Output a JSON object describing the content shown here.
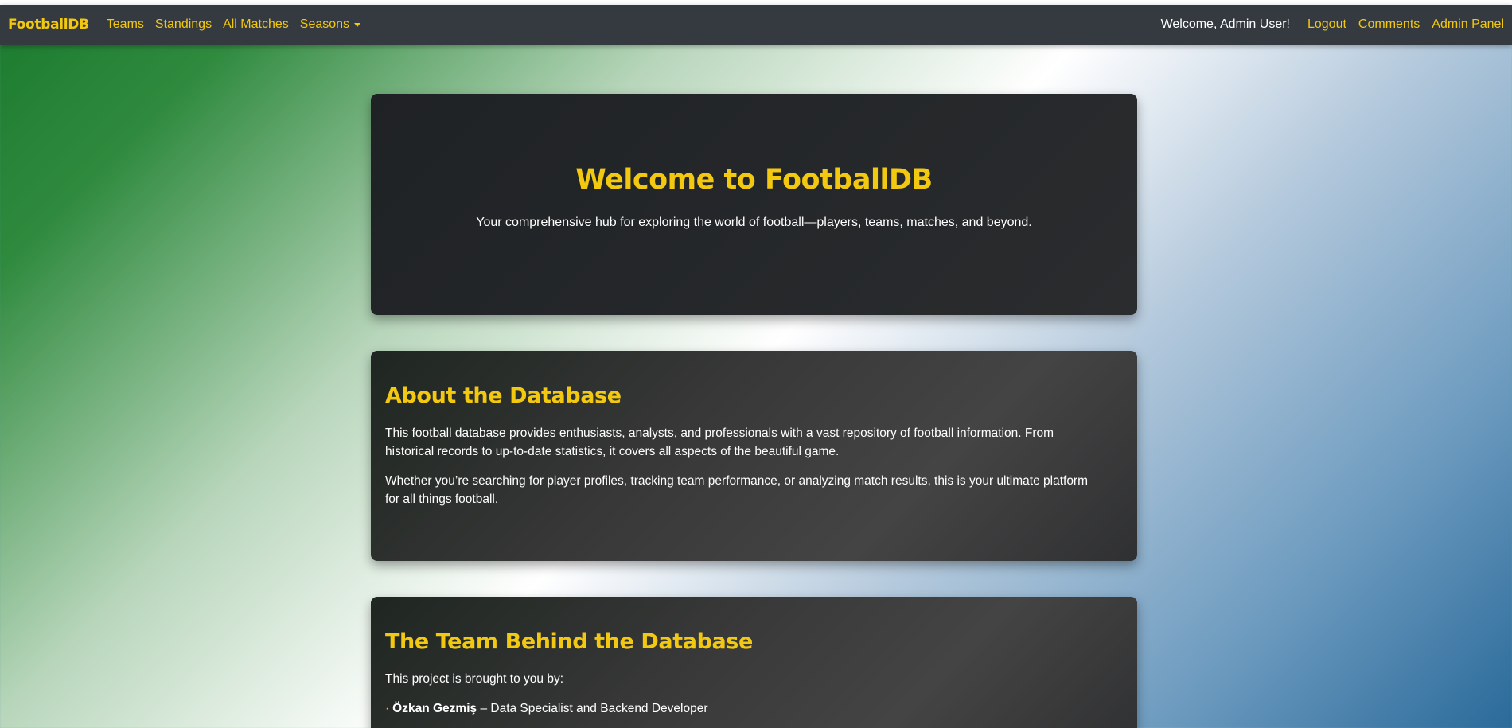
{
  "navbar": {
    "brand": "FootballDB",
    "links": [
      "Teams",
      "Standings",
      "All Matches",
      "Seasons"
    ],
    "welcome": "Welcome, Admin User!",
    "right_links": [
      "Logout",
      "Comments",
      "Admin Panel"
    ]
  },
  "hero": {
    "title": "Welcome to FootballDB",
    "subtitle": "Your comprehensive hub for exploring the world of football—players, teams, matches, and beyond."
  },
  "about": {
    "title": "About the Database",
    "paragraphs": [
      "This football database provides enthusiasts, analysts, and professionals with a vast repository of football information. From historical records to up-to-date statistics, it covers all aspects of the beautiful game.",
      "Whether you’re searching for player profiles, tracking team performance, or analyzing match results, this is your ultimate platform for all things football."
    ]
  },
  "team": {
    "title": "The Team Behind the Database",
    "intro": "This project is brought to you by:",
    "members": [
      {
        "bullet": "·",
        "name": "Özkan Gezmiş",
        "role": "– Data Specialist and Backend Developer"
      }
    ]
  },
  "colors": {
    "accent": "#f2c811",
    "navbar_bg": "#343a40",
    "card_bg": "#212529"
  }
}
